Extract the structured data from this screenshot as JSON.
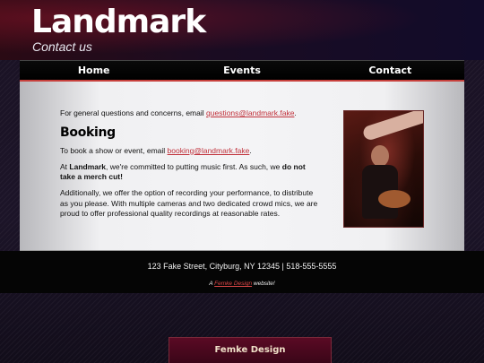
{
  "header": {
    "logo": "Landmark",
    "tagline": "Contact us"
  },
  "nav": {
    "items": [
      {
        "label": "Home"
      },
      {
        "label": "Events"
      },
      {
        "label": "Contact"
      }
    ]
  },
  "main": {
    "general_prefix": "For general questions and concerns, email ",
    "general_email": "questions@landmark.fake",
    "general_suffix": ".",
    "booking_heading": "Booking",
    "booking_prefix": "To book a show or event, email ",
    "booking_email": "booking@landmark.fake",
    "booking_suffix": ".",
    "music_prefix": "At ",
    "music_brand": "Landmark",
    "music_middle": ", we're committed to putting music first. As such, we ",
    "music_bold": "do not take a merch cut!",
    "recording_text": "Additionally, we offer the option of recording your performance, to distribute as you please. With multiple cameras and two dedicated crowd mics, we are proud to offer professional quality recordings at reasonable rates."
  },
  "footer": {
    "address": "123 Fake Street, Cityburg, NY 12345 | 518-555-5555",
    "credit_prefix": "A ",
    "credit_link": "Femke Design",
    "credit_suffix": " website!"
  },
  "femke_button": {
    "label": "Femke Design"
  },
  "colors": {
    "accent": "#c0303a",
    "nav_underline": "#c8403c",
    "button_bg": "#5a0a24"
  }
}
